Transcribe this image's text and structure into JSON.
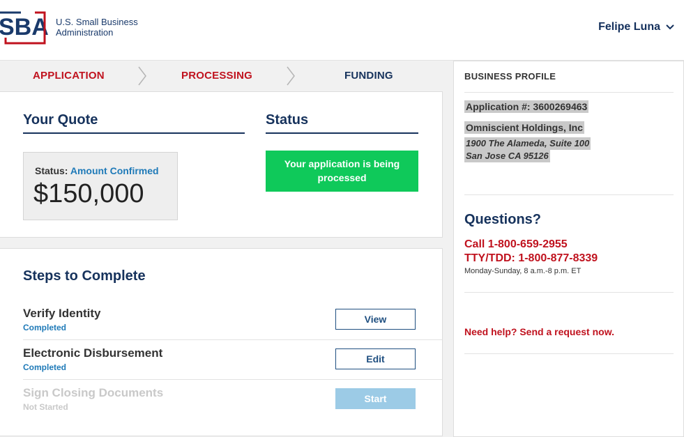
{
  "header": {
    "logo_text_line1": "U.S. Small Business",
    "logo_text_line2": "Administration",
    "user_name": "Felipe Luna"
  },
  "progress_steps": [
    {
      "label": "APPLICATION",
      "color": "#c0121e"
    },
    {
      "label": "PROCESSING",
      "color": "#c0121e"
    },
    {
      "label": "FUNDING",
      "color": "#16325c"
    }
  ],
  "quote": {
    "title": "Your Quote",
    "status_label": "Status:",
    "status_value": "Amount Confirmed",
    "amount": "$150,000"
  },
  "status": {
    "title": "Status",
    "message": "Your application is being processed"
  },
  "steps_to_complete": {
    "title": "Steps to Complete",
    "tasks": [
      {
        "name": "Verify Identity",
        "status": "Completed",
        "button": "View",
        "enabled": true
      },
      {
        "name": "Electronic Disbursement",
        "status": "Completed",
        "button": "Edit",
        "enabled": true
      },
      {
        "name": "Sign Closing Documents",
        "status": "Not Started",
        "button": "Start",
        "enabled": false
      }
    ]
  },
  "business_profile": {
    "title": "BUSINESS PROFILE",
    "application_number": "Application #: 3600269463",
    "company": "Omniscient Holdings, Inc",
    "address_line1": "1900 The Alameda, Suite 100",
    "address_line2": "San Jose CA 95126"
  },
  "questions": {
    "title": "Questions?",
    "call": "Call 1-800-659-2955",
    "tty": "TTY/TDD: 1-800-877-8339",
    "hours": "Monday-Sunday, 8 a.m.-8 p.m. ET",
    "help_link": "Need help? Send a request now."
  },
  "colors": {
    "navy": "#16325c",
    "red": "#c0121e",
    "green": "#0fc95a",
    "link_blue": "#1f7ab8"
  }
}
